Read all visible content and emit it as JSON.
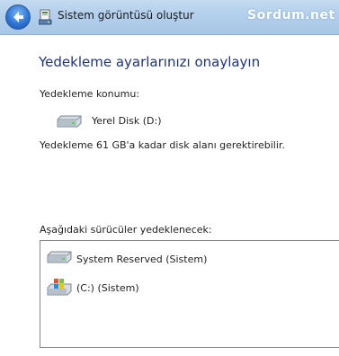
{
  "window": {
    "title": "Sistem görüntüsü oluştur",
    "watermark": "Sordum.net"
  },
  "page": {
    "heading": "Yedekleme ayarlarınızı onaylayın",
    "backup_location_label": "Yedekleme konumu:",
    "backup_location_value": "Yerel Disk (D:)",
    "space_note": "Yedekleme 61 GB'a kadar disk alanı gerektirebilir.",
    "drives_label": "Aşağıdaki sürücüler yedeklenecek:",
    "drives": [
      {
        "name": "System Reserved (Sistem)",
        "icon": "hard-drive-icon"
      },
      {
        "name": "(C:) (Sistem)",
        "icon": "windows-drive-icon"
      }
    ]
  },
  "colors": {
    "heading": "#1e3287",
    "titlebar": "#b3cfec",
    "back_button": "#2e76d6"
  }
}
